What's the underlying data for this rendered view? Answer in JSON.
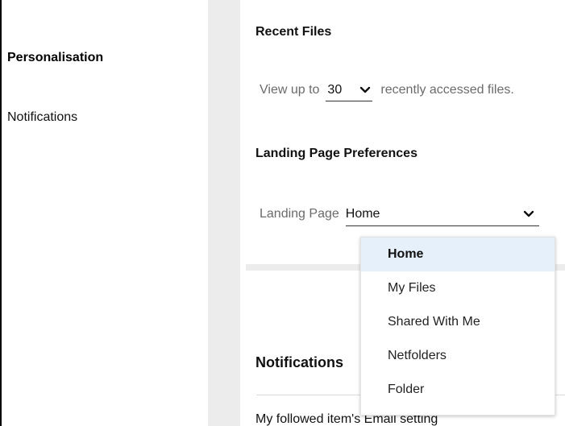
{
  "sidebar": {
    "items": [
      {
        "label": "Personalisation",
        "active": true
      },
      {
        "label": "Notifications",
        "active": false
      }
    ]
  },
  "recent_files": {
    "heading": "Recent Files",
    "prefix": "View up to",
    "count": "30",
    "suffix": "recently accessed files."
  },
  "landing_page": {
    "heading": "Landing Page Preferences",
    "label": "Landing Page",
    "value": "Home",
    "options": [
      "Home",
      "My Files",
      "Shared With Me",
      "Netfolders",
      "Folder"
    ],
    "selected_index": 0
  },
  "notifications": {
    "heading": "Notifications",
    "first_setting": "My followed item's Email setting"
  },
  "colors": {
    "gutter": "#ececec",
    "selected_option_bg": "#e6f0fb",
    "muted_text": "#6b6b6b"
  },
  "icons": [
    "chevron-down-icon"
  ]
}
